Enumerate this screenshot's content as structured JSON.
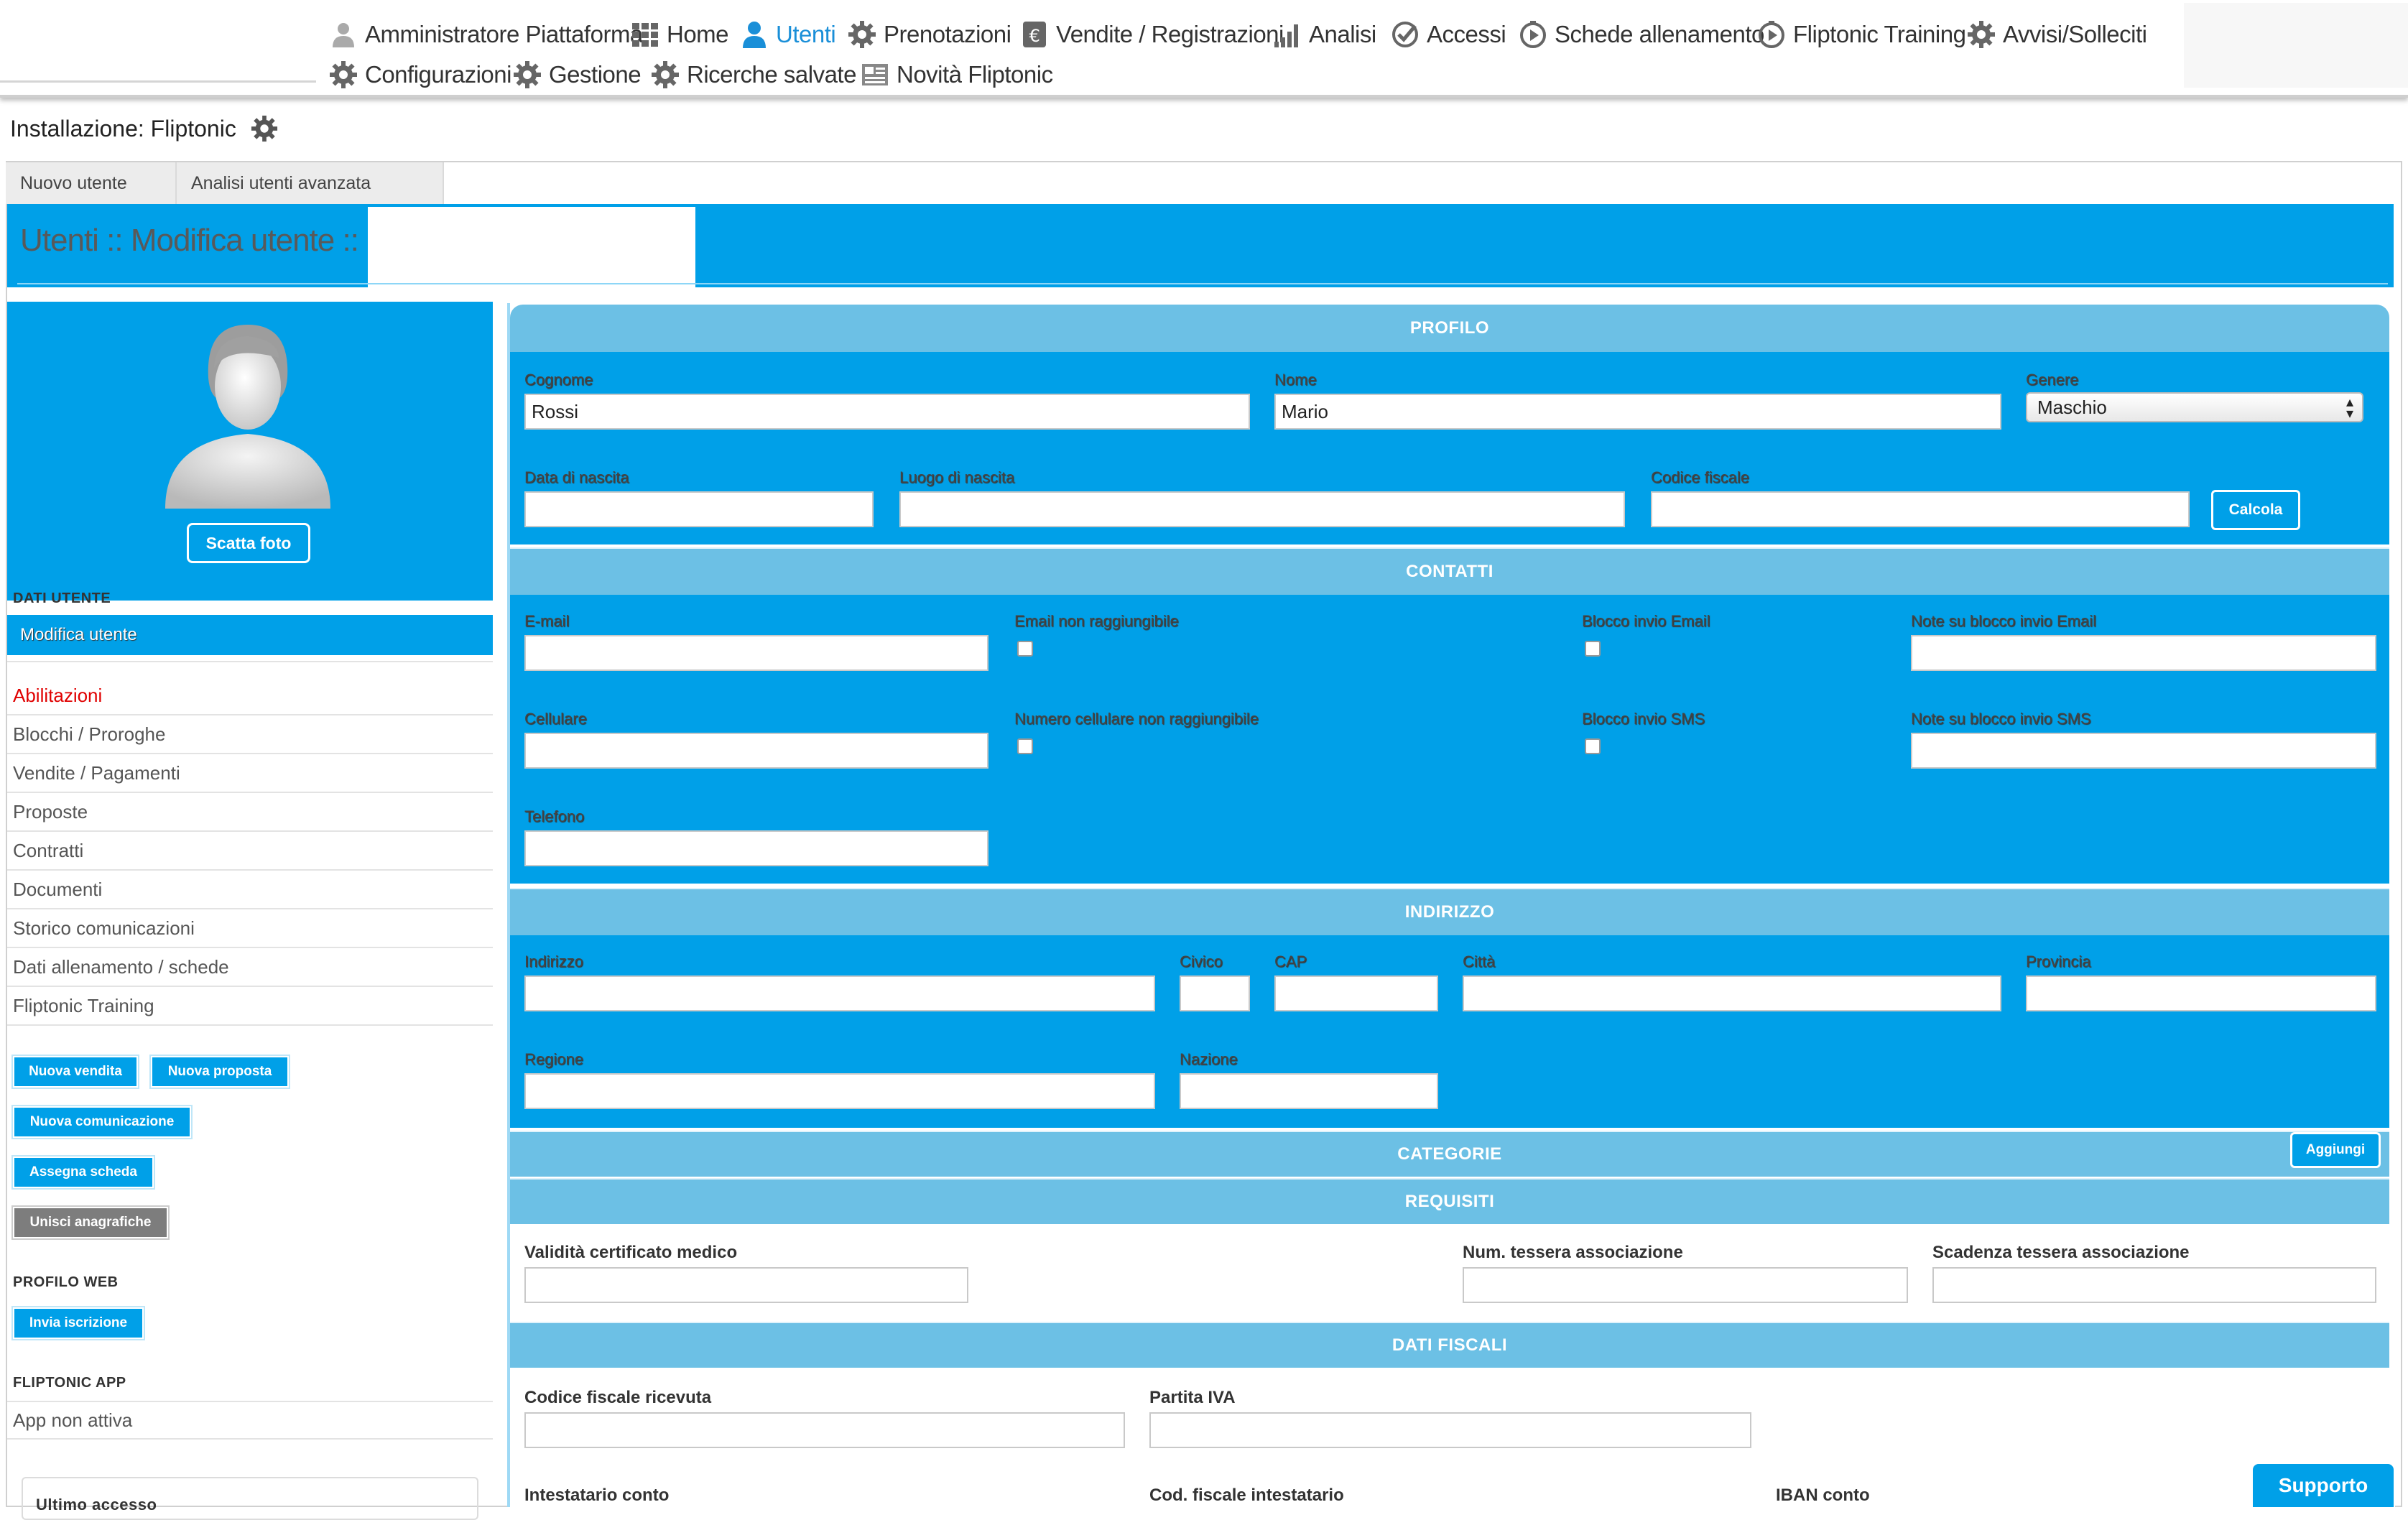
{
  "nav": {
    "items": [
      {
        "label": "Amministratore Piattaforma",
        "icon": "user-grey-icon"
      },
      {
        "label": "Home",
        "icon": "grid-icon"
      },
      {
        "label": "Utenti",
        "icon": "user-icon",
        "active": true
      },
      {
        "label": "Prenotazioni",
        "icon": "gear-icon"
      },
      {
        "label": "Vendite / Registrazioni",
        "icon": "euro-icon"
      },
      {
        "label": "Analisi",
        "icon": "signal-bars-icon"
      },
      {
        "label": "Accessi",
        "icon": "check-circle-icon"
      },
      {
        "label": "Schede allenamento",
        "icon": "play-clock-icon"
      },
      {
        "label": "Fliptonic Training",
        "icon": "play-clock-icon"
      },
      {
        "label": "Avvisi/Solleciti",
        "icon": "gear-icon"
      },
      {
        "label": "Configurazioni",
        "icon": "gear-icon"
      },
      {
        "label": "Gestione",
        "icon": "gear-icon"
      },
      {
        "label": "Ricerche salvate",
        "icon": "gear-icon"
      },
      {
        "label": "Novità Fliptonic",
        "icon": "newspaper-icon"
      }
    ]
  },
  "installation": {
    "label": "Installazione: Fliptonic"
  },
  "tabs": [
    "Nuovo utente",
    "Analisi utenti avanzata"
  ],
  "page_title": "Utenti :: Modifica utente ::",
  "left": {
    "photo_button": "Scatta foto",
    "dati_utente_label": "DATI UTENTE",
    "active_item": "Modifica utente",
    "menu": [
      "Abilitazioni",
      "Blocchi / Proroghe",
      "Vendite / Pagamenti",
      "Proposte",
      "Contratti",
      "Documenti",
      "Storico comunicazioni",
      "Dati allenamento / schede",
      "Fliptonic Training"
    ],
    "buttons": {
      "nuova_vendita": "Nuova vendita",
      "nuova_proposta": "Nuova proposta",
      "nuova_comunicazione": "Nuova comunicazione",
      "assegna_scheda": "Assegna scheda",
      "unisci_anagrafiche": "Unisci anagrafiche"
    },
    "profilo_web_label": "PROFILO WEB",
    "invia_iscrizione": "Invia iscrizione",
    "fliptonic_app_label": "FLIPTONIC APP",
    "app_status": "App non attiva",
    "ultimo_accesso": "Ultimo accesso"
  },
  "profilo": {
    "heading": "PROFILO",
    "cognome_label": "Cognome",
    "cognome_value": "Rossi",
    "nome_label": "Nome",
    "nome_value": "Mario",
    "genere_label": "Genere",
    "genere_value": "Maschio",
    "data_nascita_label": "Data di nascita",
    "luogo_nascita_label": "Luogo di nascita",
    "codice_fiscale_label": "Codice fiscale",
    "calcola": "Calcola"
  },
  "contatti": {
    "heading": "CONTATTI",
    "email_label": "E-mail",
    "email_non_raggiungibile": "Email non raggiungibile",
    "blocco_email": "Blocco invio Email",
    "note_blocco_email": "Note su blocco invio Email",
    "cellulare_label": "Cellulare",
    "cell_non_raggiungibile": "Numero cellulare non raggiungibile",
    "blocco_sms": "Blocco invio SMS",
    "note_blocco_sms": "Note su blocco invio SMS",
    "telefono_label": "Telefono"
  },
  "indirizzo": {
    "heading": "INDIRIZZO",
    "indirizzo_label": "Indirizzo",
    "civico_label": "Civico",
    "cap_label": "CAP",
    "citta_label": "Città",
    "provincia_label": "Provincia",
    "regione_label": "Regione",
    "nazione_label": "Nazione"
  },
  "categorie": {
    "heading": "CATEGORIE",
    "aggiungi": "Aggiungi"
  },
  "requisiti": {
    "heading": "REQUISITI",
    "validita_label": "Validità certificato medico",
    "num_tessera_label": "Num. tessera associazione",
    "scadenza_tessera_label": "Scadenza tessera associazione"
  },
  "dati_fiscali": {
    "heading": "DATI FISCALI",
    "cf_ricevuta_label": "Codice fiscale ricevuta",
    "partita_iva_label": "Partita IVA",
    "intestatario_label": "Intestatario conto",
    "cf_intestatario_label": "Cod. fiscale intestatario",
    "iban_label": "IBAN conto"
  },
  "support": "Supporto",
  "colors": {
    "accent": "#00a0e8",
    "section_header": "#6cc0e5",
    "active_nav": "#1a8fd8",
    "alert_red": "#e00000"
  }
}
